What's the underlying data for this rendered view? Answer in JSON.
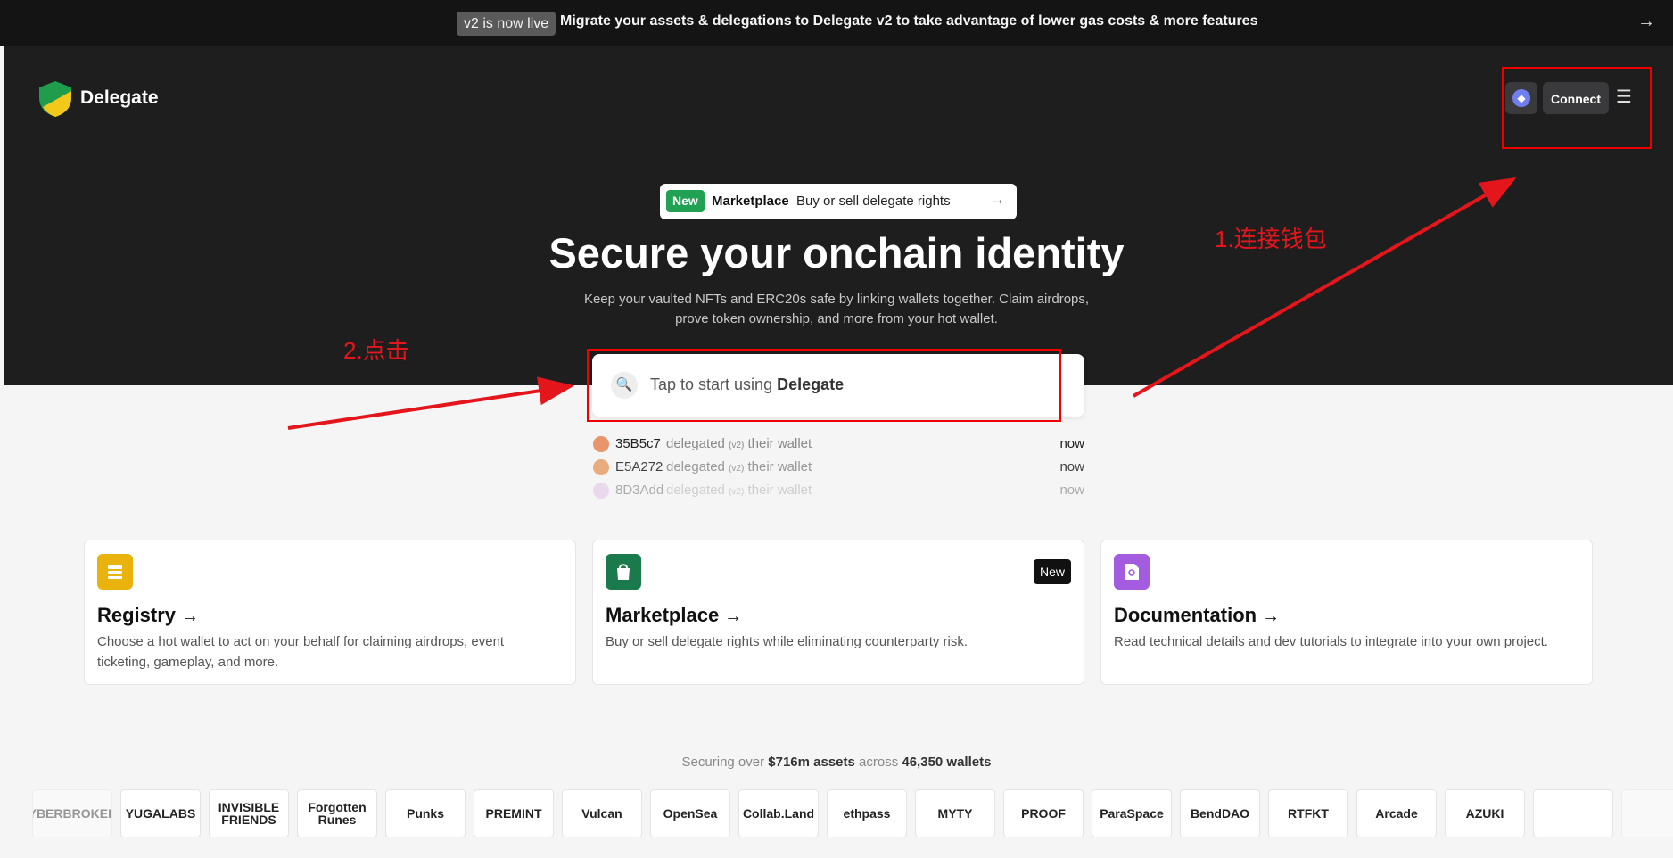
{
  "banner": {
    "pill": "v2 is now live",
    "message": "Migrate your assets & delegations to Delegate v2 to take advantage of lower gas costs & more features",
    "arrow": "→"
  },
  "header": {
    "brand": "Delegate",
    "connect_label": "Connect",
    "menu_icon": "☰",
    "eth_icon": "◆"
  },
  "announce": {
    "badge": "New",
    "title": "Marketplace",
    "text": "Buy or sell delegate rights",
    "arrow": "→"
  },
  "hero": {
    "headline": "Secure your onchain identity",
    "subline": "Keep your vaulted NFTs and ERC20s safe by linking wallets together. Claim airdrops, prove token ownership, and more from your hot wallet."
  },
  "search": {
    "icon": "🔍",
    "placeholder_prefix": "Tap to start using ",
    "placeholder_brand": "Delegate"
  },
  "annotations": {
    "step1": "1.连接钱包",
    "step2": "2.点击"
  },
  "activity": [
    {
      "id": "35B5c7",
      "action": "delegated",
      "version": "(v2)",
      "object": "their wallet",
      "when": "now"
    },
    {
      "id": "E5A272",
      "action": "delegated",
      "version": "(v2)",
      "object": "their wallet",
      "when": "now"
    },
    {
      "id": "8D3Add",
      "action": "delegated",
      "version": "(v2)",
      "object": "their wallet",
      "when": "now"
    }
  ],
  "cards": [
    {
      "title": "Registry",
      "arrow": "→",
      "desc": "Choose a hot wallet to act on your behalf for claiming airdrops, event ticketing, gameplay, and more.",
      "color": "#e9b20c"
    },
    {
      "title": "Marketplace",
      "arrow": "→",
      "desc": "Buy or sell delegate rights while eliminating counterparty risk.",
      "badge": "New",
      "color": "#1a7a4c"
    },
    {
      "title": "Documentation",
      "arrow": "→",
      "desc": "Read technical details and dev tutorials to integrate into your own project.",
      "color": "#a35be0"
    }
  ],
  "stats": {
    "prefix": "Securing over ",
    "assets": "$716m assets",
    "mid": " across ",
    "wallets": "46,350 wallets"
  },
  "logos": [
    "CYBERBROKERS",
    "YUGALABS",
    "INVISIBLE FRIENDS",
    "Forgotten Runes",
    "Punks",
    "PREMINT",
    "Vulcan",
    "OpenSea",
    "Collab.Land",
    "ethpass",
    "MYTY",
    "PROOF",
    "ParaSpace",
    "BendDAO",
    "RTFKT",
    "Arcade",
    "AZUKI",
    "",
    ""
  ]
}
